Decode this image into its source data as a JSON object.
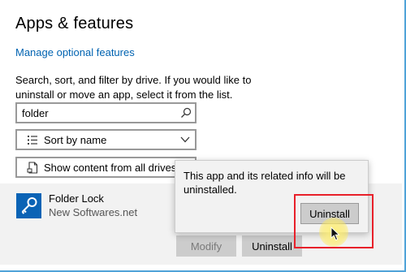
{
  "page": {
    "title": "Apps & features",
    "optional_link": "Manage optional features",
    "description": "Search, sort, and filter by drive. If you would like to uninstall or move an app, select it from the list."
  },
  "search": {
    "value": "folder",
    "icon": "search-icon"
  },
  "sort": {
    "label": "Sort by name",
    "icon": "list-sort-icon"
  },
  "filter": {
    "label": "Show content from all drives",
    "icon": "drive-document-icon"
  },
  "app": {
    "name": "Folder Lock",
    "publisher": "New Softwares.net",
    "icon": "key-icon",
    "modify_label": "Modify",
    "uninstall_label": "Uninstall"
  },
  "dialog": {
    "message": "This app and its related info will be uninstalled.",
    "confirm_label": "Uninstall"
  },
  "colors": {
    "accent": "#0063b1",
    "app_icon_bg": "#0a63b5",
    "highlight": "#e8202a",
    "window_border": "#4fa3d8"
  }
}
